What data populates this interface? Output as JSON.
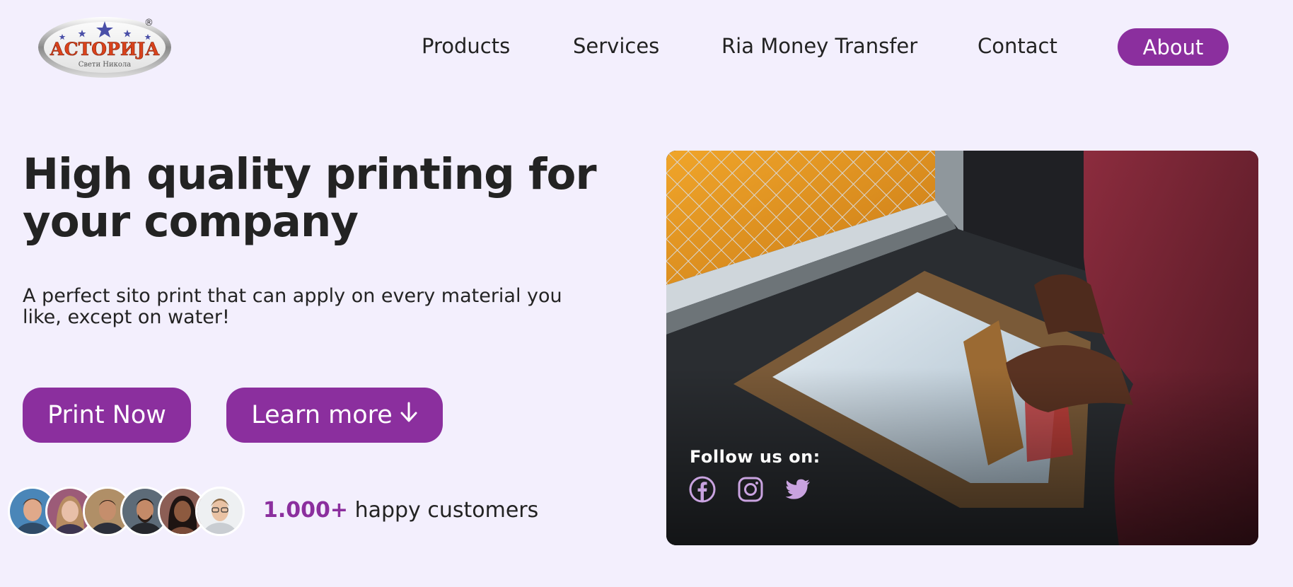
{
  "brand": {
    "logo_text": "АСТОРИЈА",
    "logo_subtext": "Свети Никола",
    "registered_mark": "®"
  },
  "nav": {
    "items": [
      {
        "label": "Products"
      },
      {
        "label": "Services"
      },
      {
        "label": "Ria Money Transfer"
      },
      {
        "label": "Contact"
      }
    ],
    "cta_label": "About"
  },
  "hero": {
    "title_line1": "High quality printing for",
    "title_line2": "your company",
    "subtitle_line1": "A perfect sito print that can apply on every material you",
    "subtitle_line2": "like, except on water!",
    "primary_button": "Print Now",
    "secondary_button": "Learn more",
    "secondary_button_icon": "arrow-down-icon"
  },
  "social_proof": {
    "count": "1.000+",
    "label": "happy customers",
    "avatar_count": 6
  },
  "photo_card": {
    "follow_label": "Follow us on:",
    "social": [
      "facebook-icon",
      "instagram-icon",
      "twitter-icon"
    ]
  },
  "colors": {
    "background": "#f3effd",
    "accent": "#8b2f9e",
    "text": "#232323",
    "social_icon": "#c9a3e0"
  }
}
